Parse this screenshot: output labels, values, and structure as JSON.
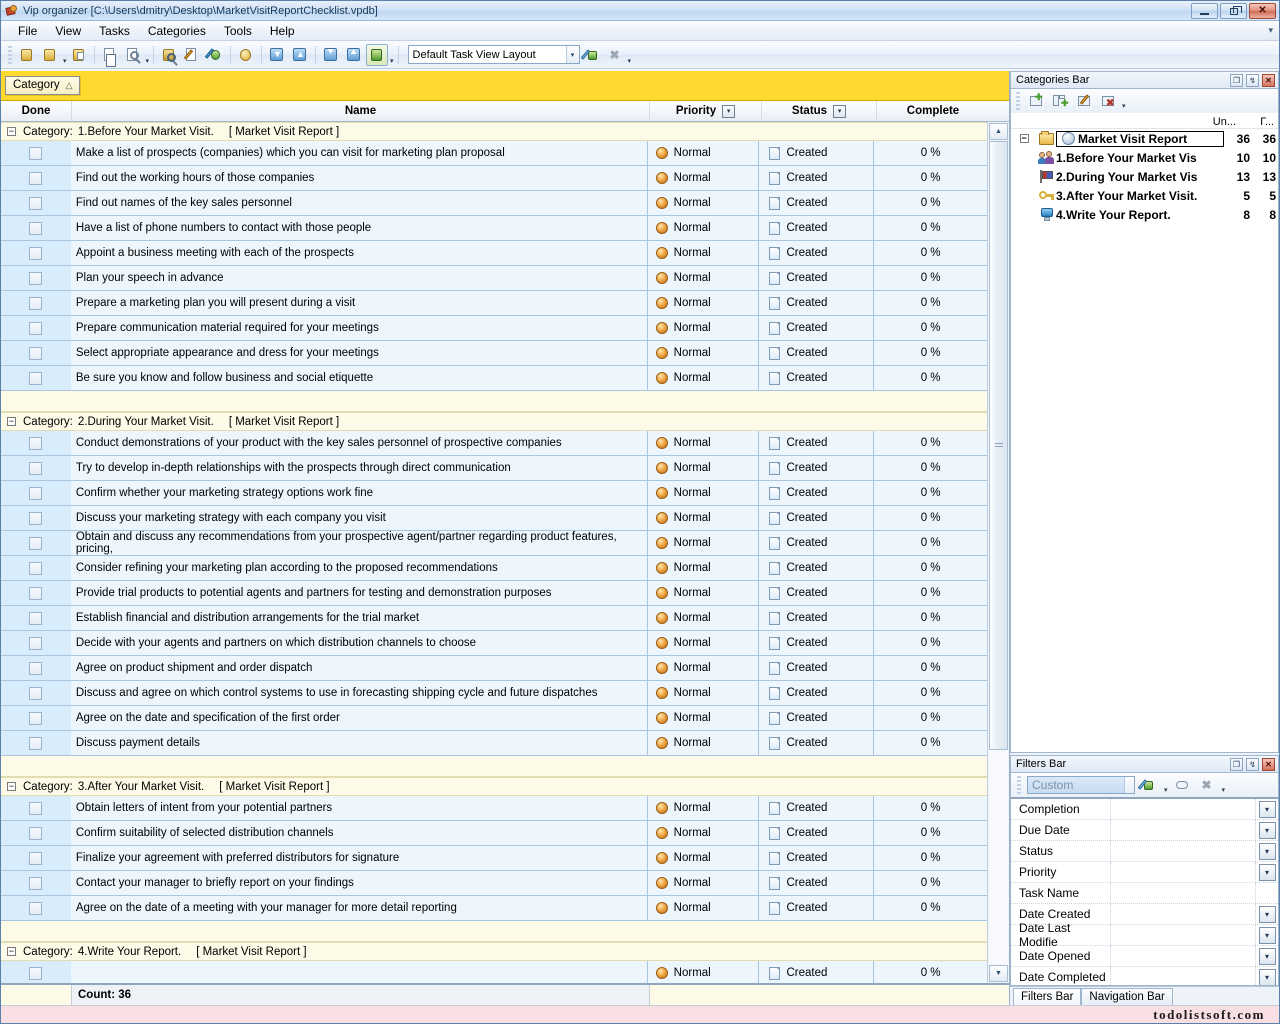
{
  "window": {
    "title": "Vip organizer [C:\\Users\\dmitry\\Desktop\\MarketVisitReportChecklist.vpdb]",
    "app_icon": "vip-organizer-icon",
    "minimize": "–",
    "restore": "❐",
    "close": "✕"
  },
  "menu": {
    "items": [
      {
        "label": "File"
      },
      {
        "label": "View"
      },
      {
        "label": "Tasks"
      },
      {
        "label": "Categories"
      },
      {
        "label": "Tools"
      },
      {
        "label": "Help"
      }
    ],
    "overflow": "▾"
  },
  "toolbar": {
    "buttons": [
      {
        "name": "new-task-icon",
        "title": "New Task"
      },
      {
        "name": "new-task-dropdown-icon",
        "title": "New Task options"
      },
      {
        "name": "save-task-icon",
        "title": "Save"
      },
      {
        "name": "print-icon",
        "title": "Print"
      },
      {
        "name": "print-preview-icon",
        "title": "Print Preview"
      },
      {
        "name": "find-task-icon",
        "title": "Find"
      },
      {
        "name": "edit-task-icon",
        "title": "Edit Task"
      },
      {
        "name": "link-task-icon",
        "title": "Link"
      },
      {
        "name": "undo-icon",
        "title": "Undo"
      },
      {
        "name": "expand-down-icon",
        "title": "Move Down"
      },
      {
        "name": "collapse-up-icon",
        "title": "Move Up"
      },
      {
        "name": "expand-all-icon",
        "title": "Expand All"
      },
      {
        "name": "collapse-all-icon",
        "title": "Collapse All"
      },
      {
        "name": "view-layout-icon",
        "title": "View Layout"
      }
    ],
    "layout_value": "Default Task View Layout",
    "layout_apply_icon": "apply-layout-icon",
    "layout_delete_icon": "delete-layout-icon",
    "overflow_caret": "▾"
  },
  "group_bar": {
    "chip_label": "Category",
    "sort_direction": "△"
  },
  "grid": {
    "columns": [
      {
        "key": "done",
        "label": "Done",
        "has_filter": false
      },
      {
        "key": "name",
        "label": "Name",
        "has_filter": false
      },
      {
        "key": "priority",
        "label": "Priority",
        "has_filter": true
      },
      {
        "key": "status",
        "label": "Status",
        "has_filter": true
      },
      {
        "key": "complete",
        "label": "Complete",
        "has_filter": false
      }
    ],
    "filter_glyph": "▾",
    "expander_collapse": "−",
    "group_prefix": "Category:",
    "groups": [
      {
        "title": "1.Before Your Market Visit.",
        "source": "[ Market Visit Report ]",
        "rows": [
          {
            "done": false,
            "name": "Make a list of prospects (companies) which you can visit for marketing plan proposal",
            "priority": "Normal",
            "status": "Created",
            "complete": "0 %"
          },
          {
            "done": false,
            "name": "Find out the working hours of those companies",
            "priority": "Normal",
            "status": "Created",
            "complete": "0 %"
          },
          {
            "done": false,
            "name": "Find out names of the key sales personnel",
            "priority": "Normal",
            "status": "Created",
            "complete": "0 %"
          },
          {
            "done": false,
            "name": "Have a list of phone numbers to contact with those people",
            "priority": "Normal",
            "status": "Created",
            "complete": "0 %"
          },
          {
            "done": false,
            "name": "Appoint a business meeting with each of the prospects",
            "priority": "Normal",
            "status": "Created",
            "complete": "0 %"
          },
          {
            "done": false,
            "name": "Plan your speech in advance",
            "priority": "Normal",
            "status": "Created",
            "complete": "0 %"
          },
          {
            "done": false,
            "name": "Prepare a marketing plan you will present during a visit",
            "priority": "Normal",
            "status": "Created",
            "complete": "0 %"
          },
          {
            "done": false,
            "name": "Prepare communication material required for your meetings",
            "priority": "Normal",
            "status": "Created",
            "complete": "0 %"
          },
          {
            "done": false,
            "name": "Select appropriate appearance and dress for your meetings",
            "priority": "Normal",
            "status": "Created",
            "complete": "0 %"
          },
          {
            "done": false,
            "name": "Be sure you know and follow business and social etiquette",
            "priority": "Normal",
            "status": "Created",
            "complete": "0 %"
          }
        ]
      },
      {
        "title": "2.During Your Market Visit.",
        "source": "[ Market Visit Report ]",
        "rows": [
          {
            "done": false,
            "name": "Conduct demonstrations of your product with the key sales personnel of prospective companies",
            "priority": "Normal",
            "status": "Created",
            "complete": "0 %"
          },
          {
            "done": false,
            "name": "Try to develop in-depth relationships with the prospects through direct communication",
            "priority": "Normal",
            "status": "Created",
            "complete": "0 %"
          },
          {
            "done": false,
            "name": "Confirm whether your marketing strategy options work fine",
            "priority": "Normal",
            "status": "Created",
            "complete": "0 %"
          },
          {
            "done": false,
            "name": "Discuss your marketing strategy with each company you visit",
            "priority": "Normal",
            "status": "Created",
            "complete": "0 %"
          },
          {
            "done": false,
            "name": "Obtain and discuss any recommendations from your prospective agent/partner regarding product features, pricing,",
            "priority": "Normal",
            "status": "Created",
            "complete": "0 %"
          },
          {
            "done": false,
            "name": "Consider refining your marketing plan according to the proposed recommendations",
            "priority": "Normal",
            "status": "Created",
            "complete": "0 %"
          },
          {
            "done": false,
            "name": "Provide trial products to potential agents and partners for testing and demonstration purposes",
            "priority": "Normal",
            "status": "Created",
            "complete": "0 %"
          },
          {
            "done": false,
            "name": "Establish financial and distribution arrangements for the trial market",
            "priority": "Normal",
            "status": "Created",
            "complete": "0 %"
          },
          {
            "done": false,
            "name": "Decide with your agents and partners on which distribution channels to choose",
            "priority": "Normal",
            "status": "Created",
            "complete": "0 %"
          },
          {
            "done": false,
            "name": "Agree on product shipment and order dispatch",
            "priority": "Normal",
            "status": "Created",
            "complete": "0 %"
          },
          {
            "done": false,
            "name": "Discuss and agree on which control systems to use in forecasting shipping cycle and future dispatches",
            "priority": "Normal",
            "status": "Created",
            "complete": "0 %"
          },
          {
            "done": false,
            "name": "Agree on the date and specification of the first order",
            "priority": "Normal",
            "status": "Created",
            "complete": "0 %"
          },
          {
            "done": false,
            "name": "Discuss payment details",
            "priority": "Normal",
            "status": "Created",
            "complete": "0 %"
          }
        ]
      },
      {
        "title": "3.After Your Market Visit.",
        "source": "[ Market Visit Report ]",
        "rows": [
          {
            "done": false,
            "name": "Obtain letters of intent from your potential partners",
            "priority": "Normal",
            "status": "Created",
            "complete": "0 %"
          },
          {
            "done": false,
            "name": "Confirm suitability of selected distribution channels",
            "priority": "Normal",
            "status": "Created",
            "complete": "0 %"
          },
          {
            "done": false,
            "name": "Finalize your agreement with preferred distributors for signature",
            "priority": "Normal",
            "status": "Created",
            "complete": "0 %"
          },
          {
            "done": false,
            "name": "Contact your manager to briefly report on your findings",
            "priority": "Normal",
            "status": "Created",
            "complete": "0 %"
          },
          {
            "done": false,
            "name": "Agree on the date of a meeting with your manager for more detail reporting",
            "priority": "Normal",
            "status": "Created",
            "complete": "0 %"
          }
        ]
      },
      {
        "title": "4.Write Your Report.",
        "source": "[ Market Visit Report ]",
        "rows": [
          {
            "done": false,
            "name": "",
            "priority": "Normal",
            "status": "Created",
            "complete": "0 %"
          }
        ]
      }
    ],
    "summary": "Count: 36",
    "scrollbar": {
      "up": "▲",
      "down": "▼"
    }
  },
  "categories_panel": {
    "title": "Categories Bar",
    "buttons": {
      "restore": "❐",
      "pin": "↯",
      "close": "✕"
    },
    "toolbar": [
      {
        "name": "new-category-icon"
      },
      {
        "name": "new-subcategory-icon"
      },
      {
        "name": "edit-category-icon"
      },
      {
        "name": "delete-category-icon"
      }
    ],
    "toolbar_caret": "▾",
    "col_headers": [
      "Un...",
      "Г..."
    ],
    "tree": [
      {
        "level": 0,
        "icon": "globe-icon",
        "label": "Market Visit Report",
        "un": "36",
        "total": "36",
        "selected": true,
        "expander": "−"
      },
      {
        "level": 1,
        "icon": "people-icon",
        "label": "1.Before Your Market Vis",
        "un": "10",
        "total": "10",
        "selected": false
      },
      {
        "level": 1,
        "icon": "flag-icon",
        "label": "2.During Your Market Vis",
        "un": "13",
        "total": "13",
        "selected": false
      },
      {
        "level": 1,
        "icon": "key-icon",
        "label": "3.After Your Market Visit.",
        "un": "5",
        "total": "5",
        "selected": false
      },
      {
        "level": 1,
        "icon": "monitor-icon",
        "label": "4.Write Your Report.",
        "un": "8",
        "total": "8",
        "selected": false
      }
    ]
  },
  "filters_panel": {
    "title": "Filters Bar",
    "buttons": {
      "restore": "❐",
      "pin": "↯",
      "close": "✕"
    },
    "combo_placeholder": "Custom",
    "toolbar": [
      {
        "name": "apply-filter-icon"
      },
      {
        "name": "clear-filter-icon"
      },
      {
        "name": "delete-filter-icon"
      }
    ],
    "toolbar_caret": "▾",
    "rows": [
      {
        "label": "Completion",
        "value": "",
        "has_dropdown": true
      },
      {
        "label": "Due Date",
        "value": "",
        "has_dropdown": true
      },
      {
        "label": "Status",
        "value": "",
        "has_dropdown": true
      },
      {
        "label": "Priority",
        "value": "",
        "has_dropdown": true
      },
      {
        "label": "Task Name",
        "value": "",
        "has_dropdown": false
      },
      {
        "label": "Date Created",
        "value": "",
        "has_dropdown": true
      },
      {
        "label": "Date Last Modifiе",
        "value": "",
        "has_dropdown": true
      },
      {
        "label": "Date Opened",
        "value": "",
        "has_dropdown": true
      },
      {
        "label": "Date Completed",
        "value": "",
        "has_dropdown": true
      }
    ],
    "dropdown_glyph": "▾",
    "tabs": [
      {
        "label": "Filters Bar",
        "active": true
      },
      {
        "label": "Navigation Bar",
        "active": false
      }
    ]
  },
  "statusbar": {
    "watermark": "todolistsoft.com"
  }
}
